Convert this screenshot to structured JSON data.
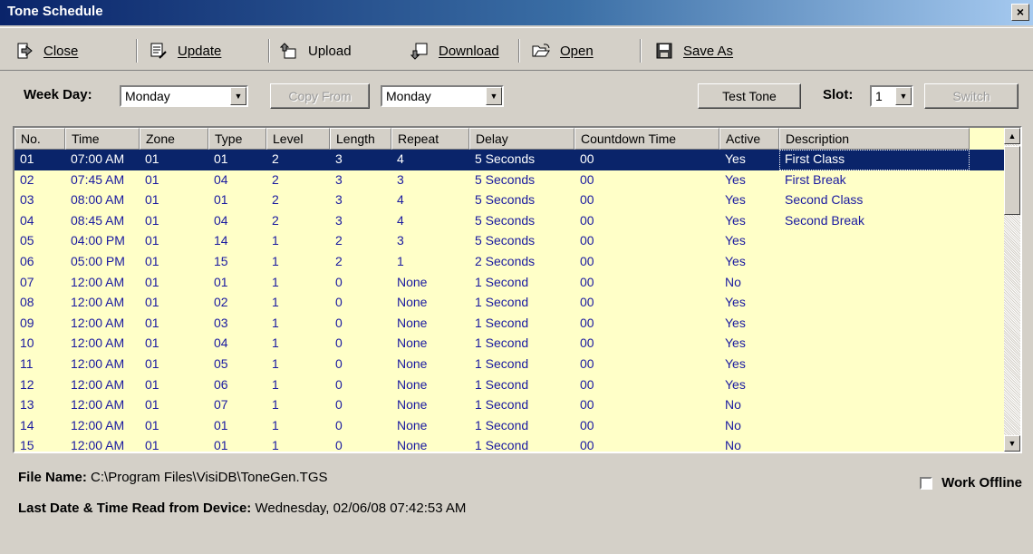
{
  "window": {
    "title": "Tone Schedule",
    "close_glyph": "×"
  },
  "toolbar": {
    "close_label": "Close",
    "update_label": "Update",
    "upload_label": "Upload",
    "download_label": "Download",
    "open_label": "Open",
    "save_as_label": "Save As"
  },
  "controls": {
    "week_day_label": "Week Day:",
    "week_day_value": "Monday",
    "copy_from_label": "Copy From",
    "copy_from_value": "Monday",
    "test_tone_label": "Test Tone",
    "slot_label": "Slot:",
    "slot_value": "1",
    "switch_label": "Switch"
  },
  "table": {
    "columns": [
      "No.",
      "Time",
      "Zone",
      "Type",
      "Level",
      "Length",
      "Repeat",
      "Delay",
      "Countdown Time",
      "Active",
      "Description"
    ],
    "rows": [
      [
        "01",
        "07:00 AM",
        "01",
        "01",
        "2",
        "3",
        "4",
        "5 Seconds",
        "00",
        "Yes",
        "First Class"
      ],
      [
        "02",
        "07:45 AM",
        "01",
        "04",
        "2",
        "3",
        "3",
        "5 Seconds",
        "00",
        "Yes",
        "First Break"
      ],
      [
        "03",
        "08:00 AM",
        "01",
        "01",
        "2",
        "3",
        "4",
        "5 Seconds",
        "00",
        "Yes",
        "Second Class"
      ],
      [
        "04",
        "08:45 AM",
        "01",
        "04",
        "2",
        "3",
        "4",
        "5 Seconds",
        "00",
        "Yes",
        "Second Break"
      ],
      [
        "05",
        "04:00 PM",
        "01",
        "14",
        "1",
        "2",
        "3",
        "5 Seconds",
        "00",
        "Yes",
        ""
      ],
      [
        "06",
        "05:00 PM",
        "01",
        "15",
        "1",
        "2",
        "1",
        "2 Seconds",
        "00",
        "Yes",
        ""
      ],
      [
        "07",
        "12:00 AM",
        "01",
        "01",
        "1",
        "0",
        "None",
        "1 Second",
        "00",
        "No",
        ""
      ],
      [
        "08",
        "12:00 AM",
        "01",
        "02",
        "1",
        "0",
        "None",
        "1 Second",
        "00",
        "Yes",
        ""
      ],
      [
        "09",
        "12:00 AM",
        "01",
        "03",
        "1",
        "0",
        "None",
        "1 Second",
        "00",
        "Yes",
        ""
      ],
      [
        "10",
        "12:00 AM",
        "01",
        "04",
        "1",
        "0",
        "None",
        "1 Second",
        "00",
        "Yes",
        ""
      ],
      [
        "11",
        "12:00 AM",
        "01",
        "05",
        "1",
        "0",
        "None",
        "1 Second",
        "00",
        "Yes",
        ""
      ],
      [
        "12",
        "12:00 AM",
        "01",
        "06",
        "1",
        "0",
        "None",
        "1 Second",
        "00",
        "Yes",
        ""
      ],
      [
        "13",
        "12:00 AM",
        "01",
        "07",
        "1",
        "0",
        "None",
        "1 Second",
        "00",
        "No",
        ""
      ],
      [
        "14",
        "12:00 AM",
        "01",
        "01",
        "1",
        "0",
        "None",
        "1 Second",
        "00",
        "No",
        ""
      ],
      [
        "15",
        "12:00 AM",
        "01",
        "01",
        "1",
        "0",
        "None",
        "1 Second",
        "00",
        "No",
        ""
      ]
    ],
    "selected_row": 0,
    "scroll_up_glyph": "▲",
    "scroll_down_glyph": "▼"
  },
  "footer": {
    "file_name_label": "File Name:",
    "file_name_value": "C:\\Program Files\\VisiDB\\ToneGen.TGS",
    "last_read_label": "Last Date & Time Read from Device:",
    "last_read_value": "Wednesday, 02/06/08 07:42:53 AM",
    "work_offline_label": "Work Offline"
  },
  "icons": {
    "close": "exit-door-icon",
    "update": "update-document-icon",
    "upload": "upload-icon",
    "download": "download-icon",
    "open": "open-folder-icon",
    "save_as": "floppy-disk-icon"
  },
  "colors": {
    "title_bar": "#0a246a",
    "grid_background": "#ffffc8",
    "grid_text": "#1a1aa0",
    "selection": "#0a246a"
  }
}
